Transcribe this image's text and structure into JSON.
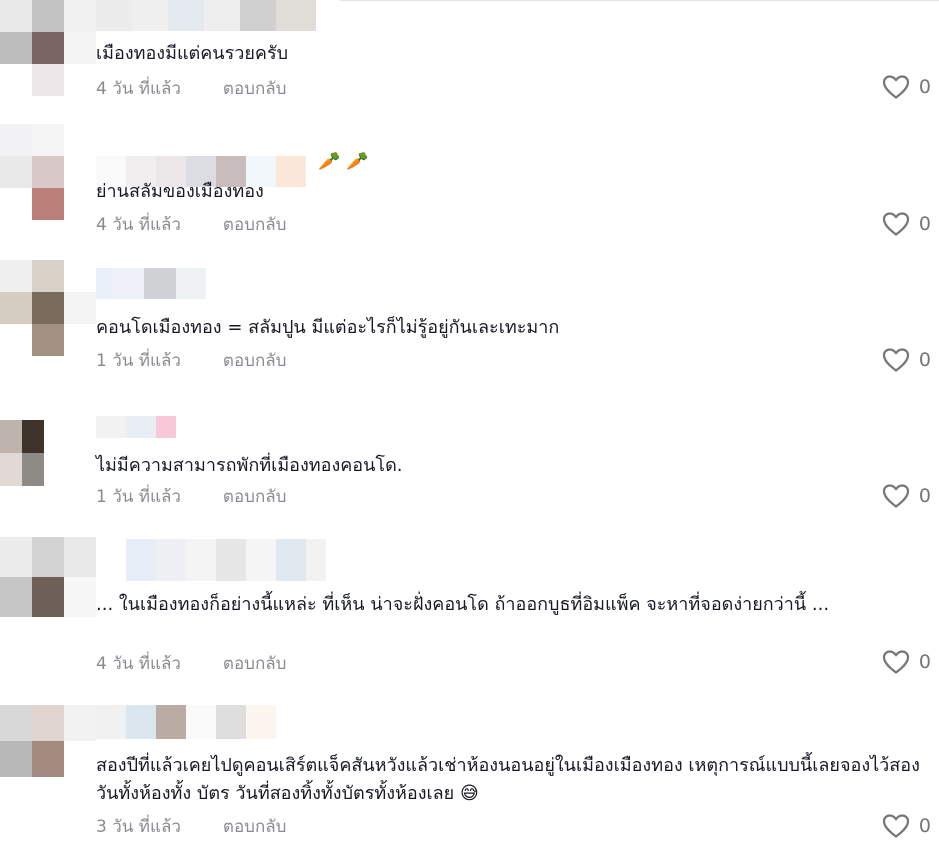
{
  "colors": {
    "text": "#161823",
    "meta": "#8a8b91",
    "like_icon": "#75767a"
  },
  "comments": [
    {
      "text": "เมืองทองมีแต่คนรวยครับ",
      "time": "4 วัน ที่แล้ว",
      "reply_label": "ตอบกลับ",
      "like_count": "0",
      "like_icon": "heart-outline-icon"
    },
    {
      "text": "ย่านสลัมของเมืองทอง",
      "time": "4 วัน ที่แล้ว",
      "reply_label": "ตอบกลับ",
      "like_count": "0",
      "like_icon": "heart-outline-icon",
      "name_emoji": "🥕 🥕"
    },
    {
      "text": "คอนโดเมืองทอง = สลัมปูน มีแต่อะไรก็ไม่รู้อยู่กันเละเทะมาก",
      "time": "1 วัน ที่แล้ว",
      "reply_label": "ตอบกลับ",
      "like_count": "0",
      "like_icon": "heart-outline-icon"
    },
    {
      "text": "ไม่มีความสามารถพักที่เมืองทองคอนโด.",
      "time": "1 วัน ที่แล้ว",
      "reply_label": "ตอบกลับ",
      "like_count": "0",
      "like_icon": "heart-outline-icon"
    },
    {
      "text": "... ในเมืองทองก็อย่างนี้แหล่ะ ที่เห็น น่าจะฝั่งคอนโด ถ้าออกบูธที่อิมแพ็ค จะหาที่จอดง่ายกว่านี้ ...",
      "time": "4 วัน ที่แล้ว",
      "reply_label": "ตอบกลับ",
      "like_count": "0",
      "like_icon": "heart-outline-icon"
    },
    {
      "text": "สองปีที่แล้วเคยไปดูคอนเสิร์ตแจ็คสันหวังแล้วเช่าห้องนอนอยู่ในเมืองเมืองทอง เหตุการณ์แบบนี้เลยจองไว้สองวันทั้งห้องทั้ง บัตร วันที่สองทิ้งทั้งบัตรทั้งห้องเลย",
      "text_emoji": "😅",
      "time": "3 วัน ที่แล้ว",
      "reply_label": "ตอบกลับ",
      "like_count": "0",
      "like_icon": "heart-outline-icon"
    }
  ]
}
